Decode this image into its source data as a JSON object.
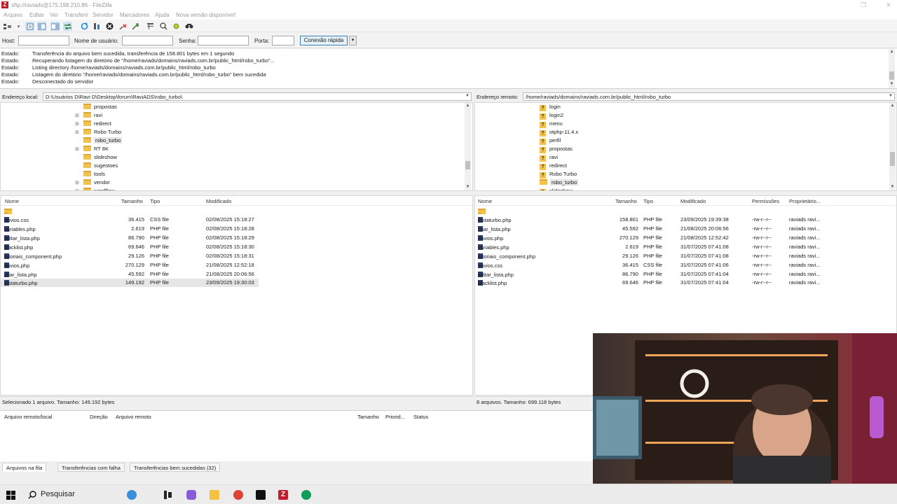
{
  "window": {
    "title": "sftp://raviads@175.198.210.86 - FileZilla",
    "app_icon": "Z",
    "controls": {
      "minimize": "—",
      "maximize": "❐",
      "close": "✕"
    }
  },
  "menu": [
    "Arquivo",
    "Editar",
    "Ver",
    "Transferir",
    "Servidor",
    "Marcadores",
    "Ajuda",
    "Nova versão disponível!"
  ],
  "toolbar_icons": [
    "site-manager-icon",
    "toggle-log-icon",
    "toggle-local-tree-icon",
    "toggle-remote-tree-icon",
    "toggle-queue-icon",
    "refresh-icon",
    "process-queue-icon",
    "cancel-icon",
    "disconnect-icon",
    "reconnect-icon",
    "filter-icon",
    "search-remote-icon",
    "compare-icon",
    "find-icon"
  ],
  "quickconnect": {
    "host_label": "Host:",
    "host_value": "",
    "user_label": "Nome de usuário:",
    "user_value": "",
    "pass_label": "Senha:",
    "pass_value": "",
    "port_label": "Porta:",
    "port_value": "",
    "connect_label": "Conexão rápida",
    "dropdown_label": "▾"
  },
  "log": [
    {
      "label": "Estado:",
      "message": "Transferência do arquivo bem sucedida, transferência de 158.801 bytes em 1 segundo"
    },
    {
      "label": "Estado:",
      "message": "Recuperando listagem do diretório de \"/home/raviads/domains/raviads.com.br/public_html/robo_turbo\"..."
    },
    {
      "label": "Estado:",
      "message": "Listing directory /home/raviads/domains/raviads.com.br/public_html/robo_turbo"
    },
    {
      "label": "Estado:",
      "message": "Listagem do diretório \"/home/raviads/domains/raviads.com.br/public_html/robo_turbo\" bem sucedida"
    },
    {
      "label": "Estado:",
      "message": "Desconectado do servidor"
    }
  ],
  "local": {
    "address_label": "Endereço local:",
    "address_value": "D:\\Usuários D\\Ravi D\\Desktop\\forum\\RaviADS\\robo_turbo\\",
    "tree": [
      {
        "name": "propostas",
        "expander": ""
      },
      {
        "name": "ravi",
        "expander": "⊞"
      },
      {
        "name": "redirect",
        "expander": "⊞"
      },
      {
        "name": "Robo Turbo",
        "expander": "⊞"
      },
      {
        "name": "robo_turbo",
        "expander": "",
        "selected": true
      },
      {
        "name": "RT 8K",
        "expander": "⊞"
      },
      {
        "name": "slideshow",
        "expander": ""
      },
      {
        "name": "sugestoes",
        "expander": ""
      },
      {
        "name": "tools",
        "expander": ""
      },
      {
        "name": "vendor",
        "expander": "⊞"
      },
      {
        "name": "wordflow",
        "expander": "⊞"
      }
    ],
    "columns": {
      "name": "Nome",
      "size": "Tamanho",
      "type": "Tipo",
      "modified": "Modificado"
    },
    "parent": "..",
    "files": [
      {
        "name": "envios.css",
        "size": "36.415",
        "type": "CSS file",
        "modified": "02/08/2025 15:18:27"
      },
      {
        "name": "variables.php",
        "size": "2.619",
        "type": "PHP file",
        "modified": "02/08/2025 15:18:28"
      },
      {
        "name": "editar_lista.php",
        "size": "86.790",
        "type": "PHP file",
        "modified": "02/08/2025 15:18:29"
      },
      {
        "name": "blacklist.php",
        "size": "69.646",
        "type": "PHP file",
        "modified": "02/08/2025 15:18:30"
      },
      {
        "name": "tutoriais_component.php",
        "size": "29.126",
        "type": "PHP file",
        "modified": "02/08/2025 15:18:31"
      },
      {
        "name": "envios.php",
        "size": "270.129",
        "type": "PHP file",
        "modified": "21/08/2025 12:52:18"
      },
      {
        "name": "criar_lista.php",
        "size": "45.592",
        "type": "PHP file",
        "modified": "21/08/2025 20:06:56"
      },
      {
        "name": "instaturbo.php",
        "size": "149.192",
        "type": "PHP file",
        "modified": "23/09/2025 19:30:03",
        "selected": true
      }
    ],
    "status": "Selecionado 1 arquivo. Tamanho: 149.192 bytes"
  },
  "remote": {
    "address_label": "Endereço remoto:",
    "address_value": "/home/raviads/domains/raviads.com.br/public_html/robo_turbo",
    "tree": [
      {
        "name": "login",
        "icon": "?"
      },
      {
        "name": "login2",
        "icon": "?"
      },
      {
        "name": "menu",
        "icon": "?"
      },
      {
        "name": "otphp-11.4.x",
        "icon": "?"
      },
      {
        "name": "perfil",
        "icon": "?"
      },
      {
        "name": "propostas",
        "icon": "?"
      },
      {
        "name": "ravi",
        "icon": "?"
      },
      {
        "name": "redirect",
        "icon": "?"
      },
      {
        "name": "Robo Turbo",
        "icon": "?"
      },
      {
        "name": "robo_turbo",
        "icon": "folder",
        "selected": true
      },
      {
        "name": "slideshow",
        "icon": "?"
      }
    ],
    "columns": {
      "name": "Nome",
      "size": "Tamanho",
      "type": "Tipo",
      "modified": "Modificado",
      "permissions": "Permissões",
      "owner": "Proprietário..."
    },
    "parent": "..",
    "files": [
      {
        "name": "instaturbo.php",
        "size": "158.801",
        "type": "PHP file",
        "modified": "23/09/2025 19:39:38",
        "permissions": "-rw-r--r--",
        "owner": "raviads ravi..."
      },
      {
        "name": "criar_lista.php",
        "size": "45.592",
        "type": "PHP file",
        "modified": "21/08/2025 20:06:56",
        "permissions": "-rw-r--r--",
        "owner": "raviads ravi..."
      },
      {
        "name": "envios.php",
        "size": "270.129",
        "type": "PHP file",
        "modified": "21/08/2025 12:52:42",
        "permissions": "-rw-r--r--",
        "owner": "raviads ravi..."
      },
      {
        "name": "variables.php",
        "size": "2.619",
        "type": "PHP file",
        "modified": "31/07/2025 07:41:08",
        "permissions": "-rw-r--r--",
        "owner": "raviads ravi..."
      },
      {
        "name": "tutoriais_component.php",
        "size": "29.126",
        "type": "PHP file",
        "modified": "31/07/2025 07:41:08",
        "permissions": "-rw-r--r--",
        "owner": "raviads ravi..."
      },
      {
        "name": "envios.css",
        "size": "36.415",
        "type": "CSS file",
        "modified": "31/07/2025 07:41:06",
        "permissions": "-rw-r--r--",
        "owner": "raviads ravi..."
      },
      {
        "name": "editar_lista.php",
        "size": "86.790",
        "type": "PHP file",
        "modified": "31/07/2025 07:41:04",
        "permissions": "-rw-r--r--",
        "owner": "raviads ravi..."
      },
      {
        "name": "blacklist.php",
        "size": "69.646",
        "type": "PHP file",
        "modified": "31/07/2025 07:41:04",
        "permissions": "-rw-r--r--",
        "owner": "raviads ravi..."
      }
    ],
    "status": "8 arquivos. Tamanho: 699.118 bytes"
  },
  "queue": {
    "columns": {
      "local_remote": "Arquivo remoto/local",
      "direction": "Direção",
      "remote_file": "Arquivo remoto",
      "size": "Tamanho",
      "priority": "Priorid...",
      "status": "Status"
    },
    "tabs": [
      "Arquivos na fila",
      "Transferências com falha",
      "Transferências bem sucedidas (32)"
    ],
    "active_tab": 0
  },
  "taskbar": {
    "search_placeholder": "Pesquisar",
    "icons": [
      "windows-start-icon",
      "search-icon",
      "widget-icon",
      "task-view-icon",
      "copilot-icon",
      "file-explorer-icon",
      "chrome-icon",
      "capcut-icon",
      "filezilla-icon",
      "chrome-profile-icon"
    ]
  },
  "colors": {
    "accent": "#3c7fb1",
    "folder": "#f3c24a",
    "filezilla_red": "#bf1e2e"
  }
}
